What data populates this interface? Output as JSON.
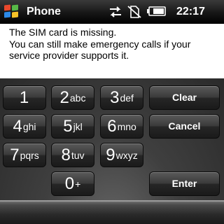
{
  "title_bar": {
    "app_title": "Phone",
    "time": "22:17"
  },
  "status_icons": [
    "data-sync-icon",
    "no-sim-icon",
    "battery-icon"
  ],
  "message": {
    "line1": "The SIM card is missing.",
    "line2": "You can still make emergency calls if your",
    "line3": "service provider supports it."
  },
  "keypad": {
    "keys": [
      {
        "digit": "1",
        "letters": ""
      },
      {
        "digit": "2",
        "letters": "abc"
      },
      {
        "digit": "3",
        "letters": "def"
      },
      {
        "digit": "4",
        "letters": "ghi"
      },
      {
        "digit": "5",
        "letters": "jkl"
      },
      {
        "digit": "6",
        "letters": "mno"
      },
      {
        "digit": "7",
        "letters": "pqrs"
      },
      {
        "digit": "8",
        "letters": "tuv"
      },
      {
        "digit": "9",
        "letters": "wxyz"
      },
      {
        "digit": "0",
        "letters": "+"
      }
    ],
    "clear_label": "Clear",
    "cancel_label": "Cancel",
    "enter_label": "Enter"
  }
}
